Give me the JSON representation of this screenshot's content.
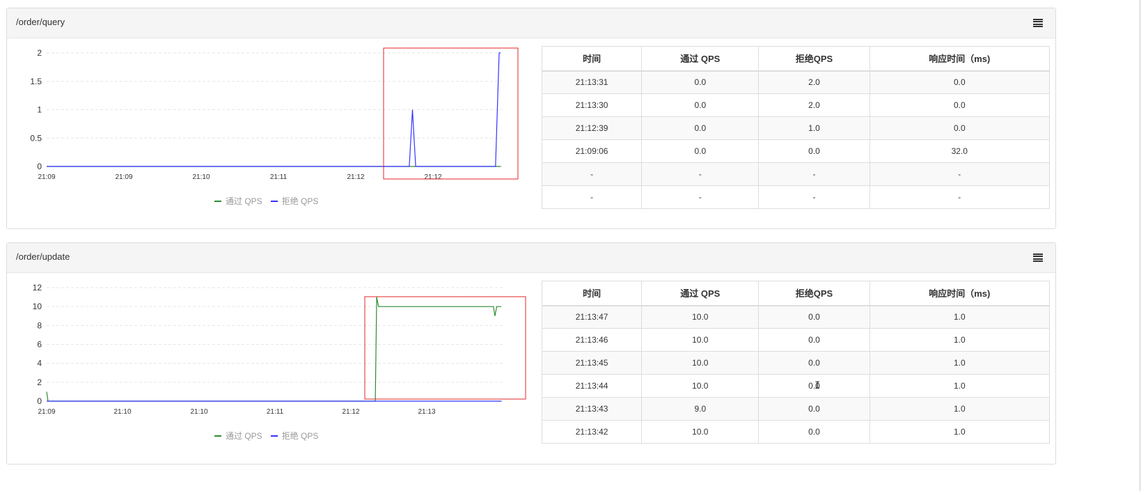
{
  "panels": [
    {
      "title": "/order/query",
      "legend": [
        {
          "label": "通过 QPS",
          "color": "#2e8b2e"
        },
        {
          "label": "拒绝 QPS",
          "color": "#3333ff"
        }
      ],
      "chart_data": {
        "type": "line",
        "x_ticks": [
          "21:09",
          "21:09",
          "21:10",
          "21:11",
          "21:12",
          "21:12"
        ],
        "y_ticks": [
          "0",
          "0.5",
          "1",
          "1.5",
          "2"
        ],
        "ylim": [
          0,
          2
        ],
        "grid": true,
        "series": [
          {
            "name": "通过 QPS",
            "color": "#2e8b2e",
            "points": [
              [
                0,
                0
              ],
              [
                1,
                0
              ]
            ]
          },
          {
            "name": "拒绝 QPS",
            "color": "#3333ff",
            "points": [
              [
                0,
                0
              ],
              [
                0.799,
                0
              ],
              [
                0.806,
                1
              ],
              [
                0.813,
                0
              ],
              [
                0.989,
                0
              ],
              [
                0.997,
                2
              ],
              [
                1.0,
                2
              ]
            ]
          }
        ],
        "highlight_box_color": "#e0262a"
      },
      "table": {
        "headers": [
          "时间",
          "通过 QPS",
          "拒绝QPS",
          "响应时间（ms)"
        ],
        "rows": [
          [
            "21:13:31",
            "0.0",
            "2.0",
            "0.0"
          ],
          [
            "21:13:30",
            "0.0",
            "2.0",
            "0.0"
          ],
          [
            "21:12:39",
            "0.0",
            "1.0",
            "0.0"
          ],
          [
            "21:09:06",
            "0.0",
            "0.0",
            "32.0"
          ],
          [
            "-",
            "-",
            "-",
            "-"
          ],
          [
            "-",
            "-",
            "-",
            "-"
          ]
        ]
      }
    },
    {
      "title": "/order/update",
      "legend": [
        {
          "label": "通过 QPS",
          "color": "#2e8b2e"
        },
        {
          "label": "拒绝 QPS",
          "color": "#3333ff"
        }
      ],
      "chart_data": {
        "type": "line",
        "x_ticks": [
          "21:09",
          "21:10",
          "21:10",
          "21:11",
          "21:12",
          "21:13"
        ],
        "y_ticks": [
          "0",
          "2",
          "4",
          "6",
          "8",
          "10",
          "12"
        ],
        "ylim": [
          0,
          12
        ],
        "grid": true,
        "series": [
          {
            "name": "通过 QPS",
            "color": "#2e8b2e",
            "points": [
              [
                0,
                1
              ],
              [
                0.003,
                0
              ],
              [
                0.723,
                0
              ],
              [
                0.726,
                11
              ],
              [
                0.73,
                10
              ],
              [
                0.983,
                10
              ],
              [
                0.986,
                9
              ],
              [
                0.99,
                10
              ],
              [
                1.0,
                10
              ]
            ]
          },
          {
            "name": "拒绝 QPS",
            "color": "#3333ff",
            "points": [
              [
                0,
                0
              ],
              [
                1,
                0
              ]
            ]
          }
        ],
        "highlight_box_color": "#e0262a"
      },
      "table": {
        "headers": [
          "时间",
          "通过 QPS",
          "拒绝QPS",
          "响应时间（ms)"
        ],
        "rows": [
          [
            "21:13:47",
            "10.0",
            "0.0",
            "1.0"
          ],
          [
            "21:13:46",
            "10.0",
            "0.0",
            "1.0"
          ],
          [
            "21:13:45",
            "10.0",
            "0.0",
            "1.0"
          ],
          [
            "21:13:44",
            "10.0",
            "0.0",
            "1.0"
          ],
          [
            "21:13:43",
            "9.0",
            "0.0",
            "1.0"
          ],
          [
            "21:13:42",
            "10.0",
            "0.0",
            "1.0"
          ]
        ]
      }
    }
  ]
}
